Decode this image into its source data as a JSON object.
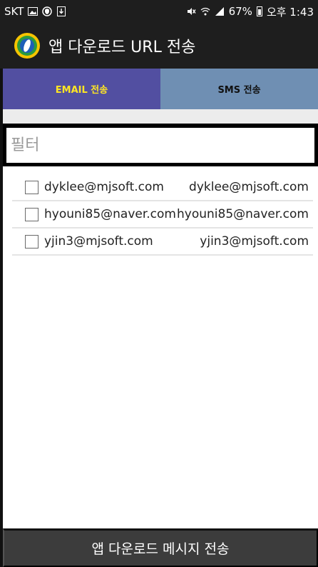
{
  "status_bar": {
    "carrier": "SKT",
    "left_icons": [
      "image-icon",
      "shield-icon",
      "download-icon"
    ],
    "right_icons": [
      "mute-icon",
      "wifi-icon",
      "signal-icon"
    ],
    "battery": "67%",
    "time": "오후 1:43"
  },
  "app_bar": {
    "title": "앱 다운로드 URL 전송"
  },
  "tabs": [
    {
      "label": "EMAIL 전송",
      "active": true
    },
    {
      "label": "SMS 전송",
      "active": false
    }
  ],
  "filter": {
    "placeholder": "필터",
    "value": ""
  },
  "items": [
    {
      "checked": false,
      "email": "dyklee@mjsoft.com",
      "address": "dyklee@mjsoft.com"
    },
    {
      "checked": false,
      "email": "hyouni85@naver.com",
      "address": "hyouni85@naver.com"
    },
    {
      "checked": false,
      "email": "yjin3@mjsoft.com",
      "address": "yjin3@mjsoft.com"
    }
  ],
  "send_button": {
    "label": "앱 다운로드 메시지 전송"
  },
  "colors": {
    "tab_active_bg": "#524fa1",
    "tab_active_text": "#ffe623",
    "tab_inactive_bg": "#6f8fb3"
  }
}
